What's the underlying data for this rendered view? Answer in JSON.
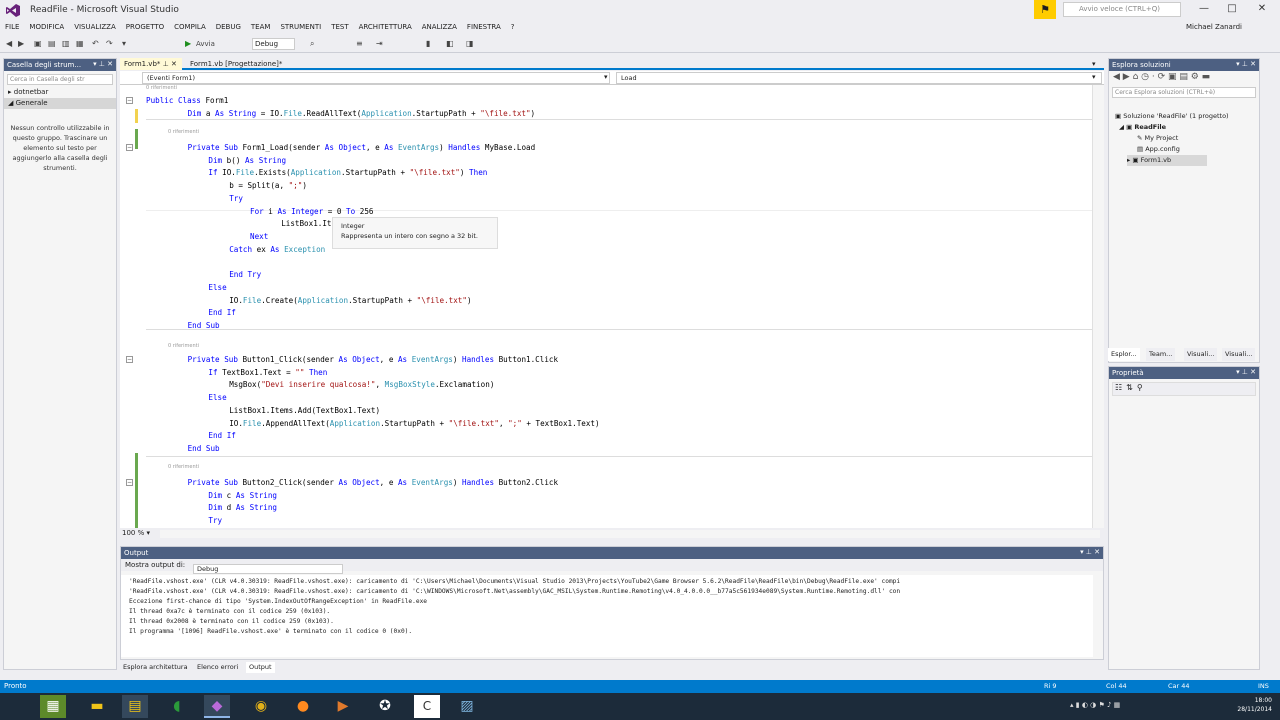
{
  "window": {
    "title": "ReadFile - Microsoft Visual Studio",
    "minimize": "—",
    "maximize": "□",
    "close": "✕"
  },
  "quicklaunch": {
    "placeholder": "Avvio veloce (CTRL+Q)"
  },
  "user": {
    "name": "Michael Zanardi"
  },
  "menu": [
    "FILE",
    "MODIFICA",
    "VISUALIZZA",
    "PROGETTO",
    "COMPILA",
    "DEBUG",
    "TEAM",
    "STRUMENTI",
    "TEST",
    "ARCHITETTURA",
    "ANALIZZA",
    "FINESTRA",
    "?"
  ],
  "toolbar": {
    "start_label": "Avvia",
    "config": "Debug"
  },
  "toolbox": {
    "title": "Casella degli strum...",
    "search_placeholder": "Cerca in Casella degli str",
    "groups": [
      "dotnetbar",
      "Generale"
    ],
    "empty_message": "Nessun controllo utilizzabile in questo gruppo. Trascinare un elemento sul testo per aggiungerlo alla casella degli strumenti."
  },
  "tabs": [
    {
      "label": "Form1.vb*"
    },
    {
      "label": "Form1.vb [Progettazione]*"
    }
  ],
  "navbar": {
    "left": "(Eventi Form1)",
    "right": "Load"
  },
  "code": {
    "lens": "0 riferimenti",
    "lines": [
      {
        "kind": "class",
        "text": "Public Class Form1"
      },
      {
        "kind": "dim_a",
        "text": "Dim a As String = IO.File.ReadAllText(Application.StartupPath + \"\\file.txt\")"
      },
      {
        "kind": "sub",
        "text": "Private Sub Form1_Load(sender As Object, e As EventArgs) Handles MyBase.Load"
      },
      {
        "kind": "plain",
        "text": "Dim b() As String"
      },
      {
        "kind": "plain",
        "text": "If IO.File.Exists(Application.StartupPath + \"\\file.txt\") Then"
      },
      {
        "kind": "plain",
        "text": "b = Split(a, \";\")"
      },
      {
        "kind": "plain",
        "text": "Try"
      },
      {
        "kind": "plain",
        "text": "For i As Integer = 0 To 256"
      },
      {
        "kind": "plain",
        "text": "ListBox1.Items."
      },
      {
        "kind": "plain",
        "text": "Next"
      },
      {
        "kind": "plain",
        "text": "Catch ex As Exception"
      },
      {
        "kind": "plain",
        "text": "End Try"
      },
      {
        "kind": "plain",
        "text": "Else"
      },
      {
        "kind": "plain",
        "text": "IO.File.Create(Application.StartupPath + \"\\file.txt\")"
      },
      {
        "kind": "plain",
        "text": "End If"
      },
      {
        "kind": "plain",
        "text": "End Sub"
      },
      {
        "kind": "plain",
        "text": "Private Sub Button1_Click(sender As Object, e As EventArgs) Handles Button1.Click"
      },
      {
        "kind": "plain",
        "text": "If TextBox1.Text = \"\" Then"
      },
      {
        "kind": "plain",
        "text": "MsgBox(\"Devi inserire qualcosa!\", MsgBoxStyle.Exclamation)"
      },
      {
        "kind": "plain",
        "text": "Else"
      },
      {
        "kind": "plain",
        "text": "ListBox1.Items.Add(TextBox1.Text)"
      },
      {
        "kind": "plain",
        "text": "IO.File.AppendAllText(Application.StartupPath + \"\\file.txt\", \";\" + TextBox1.Text)"
      },
      {
        "kind": "plain",
        "text": "End If"
      },
      {
        "kind": "plain",
        "text": "End Sub"
      },
      {
        "kind": "plain",
        "text": "Private Sub Button2_Click(sender As Object, e As EventArgs) Handles Button2.Click"
      },
      {
        "kind": "plain",
        "text": "Dim c As String"
      },
      {
        "kind": "plain",
        "text": "Dim d As String"
      },
      {
        "kind": "plain",
        "text": "Try"
      }
    ]
  },
  "tooltip": {
    "title": "Integer",
    "description": "Rappresenta un intero con segno a 32 bit."
  },
  "zoom": "100 %",
  "output": {
    "title": "Output",
    "source_label": "Mostra output di:",
    "source_value": "Debug",
    "lines": [
      "'ReadFile.vshost.exe' (CLR v4.0.30319: ReadFile.vshost.exe): caricamento di 'C:\\Users\\Michael\\Documents\\Visual Studio 2013\\Projects\\YouTube2\\Game Browser 5.6.2\\ReadFile\\ReadFile\\bin\\Debug\\ReadFile.exe' compi",
      "'ReadFile.vshost.exe' (CLR v4.0.30319: ReadFile.vshost.exe): caricamento di 'C:\\WINDOWS\\Microsoft.Net\\assembly\\GAC_MSIL\\System.Runtime.Remoting\\v4.0_4.0.0.0__b77a5c561934e089\\System.Runtime.Remoting.dll' con",
      "Eccezione first-chance di tipo 'System.IndexOutOfRangeException' in ReadFile.exe",
      "Il thread 0xa7c è terminato con il codice 259 (0x103).",
      "Il thread 0x2008 è terminato con il codice 259 (0x103).",
      "Il programma '[1096] ReadFile.vshost.exe' è terminato con il codice 0 (0x0)."
    ]
  },
  "bottom_tabs": [
    "Esplora architettura",
    "Elenco errori",
    "Output"
  ],
  "solution": {
    "title": "Esplora soluzioni",
    "search_placeholder": "Cerca Esplora soluzioni (CTRL+è)",
    "nodes": [
      "Soluzione 'ReadFile' (1 progetto)",
      "ReadFile",
      "My Project",
      "App.config",
      "Form1.vb"
    ]
  },
  "side_tabs": [
    "Esplor...",
    "Team...",
    "Visuali...",
    "Visuali..."
  ],
  "properties": {
    "title": "Proprietà"
  },
  "status": {
    "left": "Pronto",
    "ln": "Ri 9",
    "col": "Col 44",
    "car": "Car 44",
    "mode": "INS"
  },
  "clock": {
    "time": "18:00",
    "date": "28/11/2014"
  },
  "colors": {
    "accent": "#007acc",
    "panel_header": "#4d6082",
    "keyword": "#0000ff",
    "type": "#2b91af",
    "string": "#a31515",
    "taskbar": "#1c2b3a"
  },
  "icons": [
    "vs-logo-icon",
    "notification-flag-icon",
    "search-icon",
    "start-debug-icon",
    "minecraft-icon",
    "file-explorer-icon",
    "visual-studio-icon",
    "chrome-icon",
    "firefox-icon"
  ]
}
